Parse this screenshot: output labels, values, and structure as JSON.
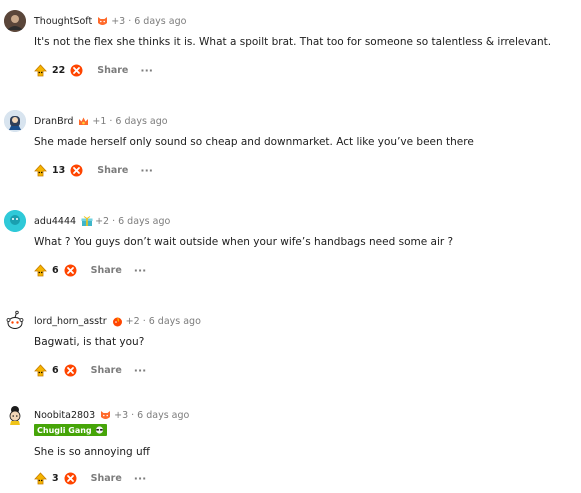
{
  "comments": [
    {
      "username": "ThoughtSoft",
      "award_icon": "cat-face-icon",
      "karma": "+3",
      "time": "6 days ago",
      "text": "It's not the flex she thinks it is. What a spoilt brat. That too for someone so talentless & irrelevant.",
      "votes": "22",
      "share": "Share",
      "more": "···"
    },
    {
      "username": "DranBrd",
      "award_icon": "fire-crown-icon",
      "karma": "+1",
      "time": "6 days ago",
      "text": "She made herself only sound so cheap and downmarket. Act like you’ve been there",
      "votes": "13",
      "share": "Share",
      "more": "···"
    },
    {
      "username": "adu4444",
      "award_icon": "gift-icon",
      "karma": "+2",
      "time": "6 days ago",
      "text": "What ? You guys don’t wait outside when your wife’s handbags need some air ?",
      "votes": "6",
      "share": "Share",
      "more": "···"
    },
    {
      "username": "lord_horn_asstr",
      "award_icon": "flame-ball-icon",
      "karma": "+2",
      "time": "6 days ago",
      "text": "Bagwati, is that you?",
      "votes": "6",
      "share": "Share",
      "more": "···"
    },
    {
      "username": "Noobita2803",
      "award_icon": "cat-face-icon",
      "karma": "+3",
      "time": "6 days ago",
      "flair": "Chugli Gang",
      "flair_icon": "sunglasses-icon",
      "text": "She is so annoying uff",
      "votes": "3",
      "share": "Share",
      "more": "···"
    }
  ],
  "colors": {
    "text": "#1c1c1c",
    "muted": "#7c7c7c",
    "downvote": "#ff4500",
    "upvote": "#f5b400",
    "flair_bg": "#46a508"
  }
}
